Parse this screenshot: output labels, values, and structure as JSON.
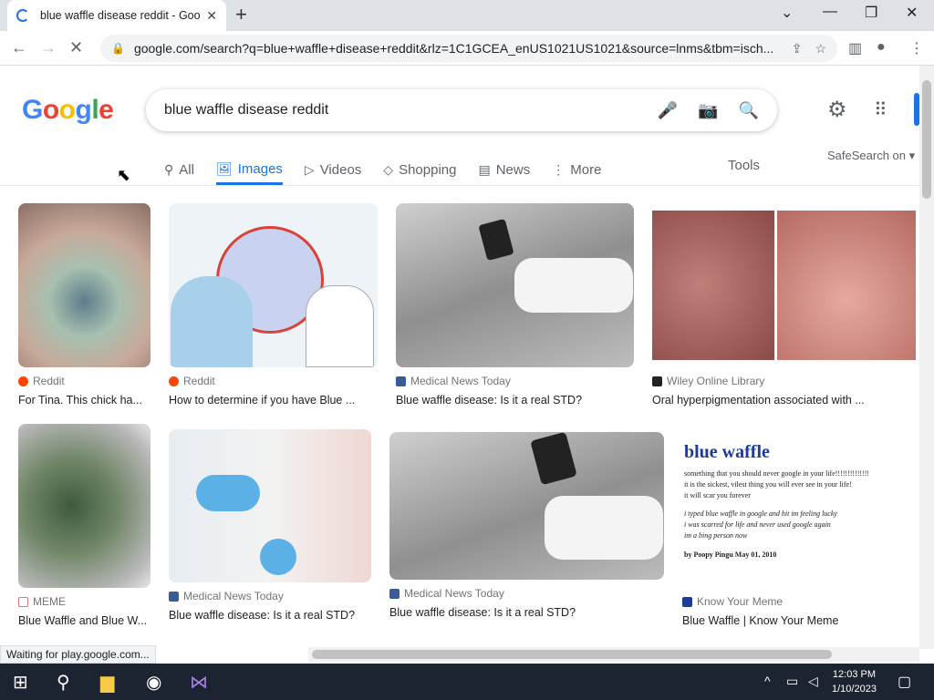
{
  "browser": {
    "tab_title": "blue waffle disease reddit - Goog",
    "url": "google.com/search?q=blue+waffle+disease+reddit&rlz=1C1GCEA_enUS1021US1021&source=lnms&tbm=isch...",
    "status": "Waiting for play.google.com..."
  },
  "google": {
    "query": "blue waffle disease reddit",
    "tabs": [
      {
        "label": "All"
      },
      {
        "label": "Images"
      },
      {
        "label": "Videos"
      },
      {
        "label": "Shopping"
      },
      {
        "label": "News"
      },
      {
        "label": "More"
      }
    ],
    "tools": "Tools",
    "safesearch": "SafeSearch on ▾"
  },
  "results": [
    {
      "source": "Reddit",
      "caption": "For Tina. This chick ha...",
      "color": "#b7a392"
    },
    {
      "source": "Reddit",
      "caption": "How to determine if you have Blue ...",
      "color": "#dce6ef"
    },
    {
      "source": "Medical News Today",
      "caption": "Blue waffle disease: Is it a real STD?",
      "color": "#9a9a9a"
    },
    {
      "source": "Wiley Online Library",
      "caption": "Oral hyperpigmentation associated with ...",
      "color": "#b06e67"
    },
    {
      "source": "MEME",
      "caption": "Blue Waffle and Blue W...",
      "color": "#6d7b64"
    },
    {
      "source": "Medical News Today",
      "caption": "Blue waffle disease: Is it a real STD?",
      "color": "#e9e4e4"
    },
    {
      "source": "Medical News Today",
      "caption": "Blue waffle disease: Is it a real STD?",
      "color": "#a09e9e"
    },
    {
      "source": "Know Your Meme",
      "caption": "Blue Waffle | Know Your Meme",
      "color": "#ffffff"
    }
  ],
  "meme_card": {
    "word": "blue waffle",
    "def_line1": "something that you should never google in your life!!!!!!!!!!!!!!",
    "def_line2": "it is the sickest, vilest thing you will ever see in your life!",
    "def_line3": "it will scar you forever",
    "ex_line1": "i typed blue waffle in google and hit im feeling lucky",
    "ex_line2": "i was scarred for life and never used google again",
    "ex_line3": "im a bing person now",
    "byline": "by Poopy Pingu May 01, 2010"
  },
  "taskbar": {
    "time": "12:03 PM",
    "date": "1/10/2023"
  }
}
